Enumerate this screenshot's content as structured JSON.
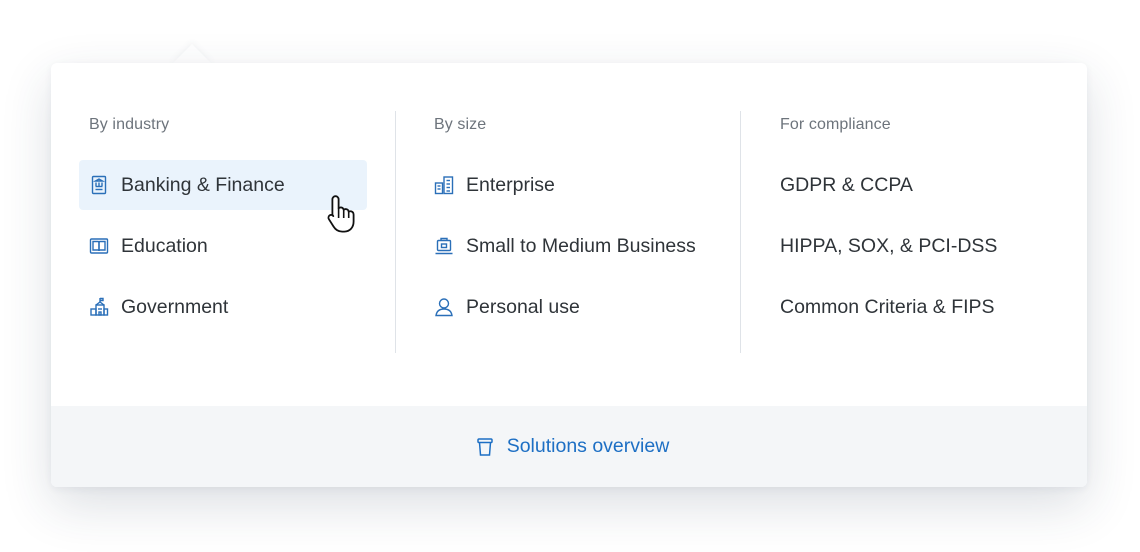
{
  "menu": {
    "columns": [
      {
        "heading": "By industry",
        "items": [
          {
            "label": "Banking & Finance",
            "icon": "bank-icon",
            "active": true
          },
          {
            "label": "Education",
            "icon": "book-icon"
          },
          {
            "label": "Government",
            "icon": "government-building-icon"
          }
        ]
      },
      {
        "heading": "By size",
        "items": [
          {
            "label": "Enterprise",
            "icon": "buildings-icon"
          },
          {
            "label": "Small to Medium Business",
            "icon": "briefcase-icon"
          },
          {
            "label": "Personal use",
            "icon": "user-icon"
          }
        ]
      },
      {
        "heading": "For compliance",
        "items": [
          {
            "label": "GDPR & CCPA"
          },
          {
            "label": "HIPPA, SOX, & PCI-DSS"
          },
          {
            "label": "Common Criteria & FIPS"
          }
        ]
      }
    ],
    "footer": {
      "label": "Solutions overview",
      "icon": "box-icon"
    }
  },
  "colors": {
    "accent": "#1d6fc4",
    "icon_blue": "#2a6fb8",
    "active_bg": "#eaf3fc",
    "footer_bg": "#f4f6f8",
    "text": "#2f3439",
    "heading": "#6d747c"
  },
  "cursor": {
    "icon": "hand-pointer-cursor-icon"
  }
}
